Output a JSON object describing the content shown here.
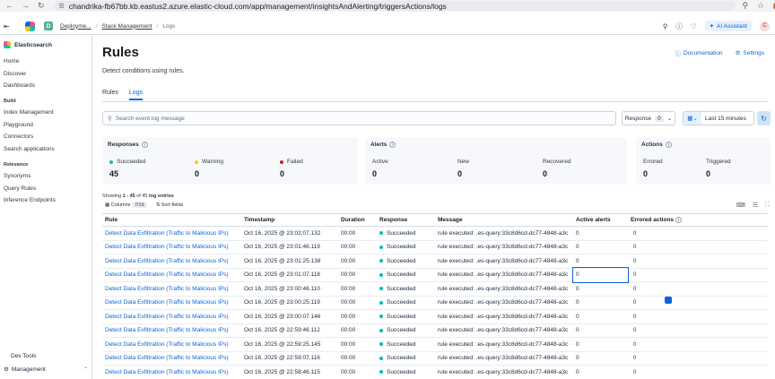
{
  "browser": {
    "url": "chandrika-fb67bb.kb.eastus2.azure.elastic-cloud.com/app/management/insightsAndAlerting/triggersActions/logs"
  },
  "header": {
    "space_initial": "D",
    "breadcrumbs": [
      "Deployme...",
      "Stack Management",
      "Logs"
    ],
    "ai_assistant": "AI Assistant",
    "user_initial": "C"
  },
  "sidebar": {
    "brand": "Elasticsearch",
    "items": [
      "Home",
      "Discover",
      "Dashboards"
    ],
    "build_heading": "Build",
    "build_items": [
      "Index Management",
      "Playground",
      "Connectors",
      "Search applications"
    ],
    "relevance_heading": "Relevance",
    "relevance_items": [
      "Synonyms",
      "Query Rules",
      "Inference Endpoints"
    ],
    "dev_tools": "Dev Tools",
    "management": "Management"
  },
  "page": {
    "title": "Rules",
    "documentation": "Documentation",
    "settings": "Settings",
    "subtitle": "Detect conditions using rules.",
    "tabs": [
      "Rules",
      "Logs"
    ],
    "search_placeholder": "Search event log message",
    "response_label": "Response",
    "response_count": "0",
    "time_range": "Last 15 minutes"
  },
  "responses": {
    "title": "Responses",
    "succeeded_label": "Succeeded",
    "succeeded": "45",
    "warning_label": "Warning",
    "warning": "0",
    "failed_label": "Failed",
    "failed": "0"
  },
  "alerts": {
    "title": "Alerts",
    "active_label": "Active",
    "active": "0",
    "new_label": "New",
    "new": "0",
    "recovered_label": "Recovered",
    "recovered": "0"
  },
  "actions": {
    "title": "Actions",
    "errored_label": "Errored",
    "errored": "0",
    "triggered_label": "Triggered",
    "triggered": "0"
  },
  "table": {
    "showing_prefix": "Showing ",
    "showing_range": "1 - 45",
    "showing_mid": " of 45 ",
    "showing_suffix": "log entries",
    "columns_label": "Columns",
    "columns_count": "7/19",
    "sort_label": "Sort fields",
    "headers": [
      "Rule",
      "Timestamp",
      "Duration",
      "Response",
      "Message",
      "Active alerts",
      "Errored actions"
    ],
    "rows": [
      {
        "rule": "Detect Data Exfiltration (Traffic to Malicious IPs)",
        "ts": "Oct 16, 2025 @ 23:02:07.132",
        "dur": "00:00",
        "resp": "Succeeded",
        "msg": "rule executed: .es-query:33c8d6cd-dc77-4848-a3c",
        "active": "0",
        "err": "0"
      },
      {
        "rule": "Detect Data Exfiltration (Traffic to Malicious IPs)",
        "ts": "Oct 16, 2025 @ 23:01:46.119",
        "dur": "00:00",
        "resp": "Succeeded",
        "msg": "rule executed: .es-query:33c8d6cd-dc77-4848-a3c",
        "active": "0",
        "err": "0"
      },
      {
        "rule": "Detect Data Exfiltration (Traffic to Malicious IPs)",
        "ts": "Oct 16, 2025 @ 23:01:25.138",
        "dur": "00:00",
        "resp": "Succeeded",
        "msg": "rule executed: .es-query:33c8d6cd-dc77-4848-a3c",
        "active": "0",
        "err": "0"
      },
      {
        "rule": "Detect Data Exfiltration (Traffic to Malicious IPs)",
        "ts": "Oct 16, 2025 @ 23:01:07.118",
        "dur": "00:00",
        "resp": "Succeeded",
        "msg": "rule executed: .es-query:33c8d6cd-dc77-4848-a3c",
        "active": "0",
        "err": "0"
      },
      {
        "rule": "Detect Data Exfiltration (Traffic to Malicious IPs)",
        "ts": "Oct 16, 2025 @ 23:00:46.110",
        "dur": "00:00",
        "resp": "Succeeded",
        "msg": "rule executed: .es-query:33c8d6cd-dc77-4848-a3c",
        "active": "0",
        "err": "0"
      },
      {
        "rule": "Detect Data Exfiltration (Traffic to Malicious IPs)",
        "ts": "Oct 16, 2025 @ 23:00:25.119",
        "dur": "00:00",
        "resp": "Succeeded",
        "msg": "rule executed: .es-query:33c8d6cd-dc77-4848-a3c",
        "active": "0",
        "err": "0"
      },
      {
        "rule": "Detect Data Exfiltration (Traffic to Malicious IPs)",
        "ts": "Oct 16, 2025 @ 23:00:07.146",
        "dur": "00:00",
        "resp": "Succeeded",
        "msg": "rule executed: .es-query:33c8d6cd-dc77-4848-a3c",
        "active": "0",
        "err": "0"
      },
      {
        "rule": "Detect Data Exfiltration (Traffic to Malicious IPs)",
        "ts": "Oct 16, 2025 @ 22:59:46.112",
        "dur": "00:00",
        "resp": "Succeeded",
        "msg": "rule executed: .es-query:33c8d6cd-dc77-4848-a3c",
        "active": "0",
        "err": "0"
      },
      {
        "rule": "Detect Data Exfiltration (Traffic to Malicious IPs)",
        "ts": "Oct 16, 2025 @ 22:59:25.145",
        "dur": "00:00",
        "resp": "Succeeded",
        "msg": "rule executed: .es-query:33c8d6cd-dc77-4848-a3c",
        "active": "0",
        "err": "0"
      },
      {
        "rule": "Detect Data Exfiltration (Traffic to Malicious IPs)",
        "ts": "Oct 16, 2025 @ 22:59:07.116",
        "dur": "00:00",
        "resp": "Succeeded",
        "msg": "rule executed: .es-query:33c8d6cd-dc77-4848-a3c",
        "active": "0",
        "err": "0"
      },
      {
        "rule": "Detect Data Exfiltration (Traffic to Malicious IPs)",
        "ts": "Oct 16, 2025 @ 22:58:46.115",
        "dur": "00:00",
        "resp": "Succeeded",
        "msg": "rule executed: .es-query:33c8d6cd-dc77-4848-a3c",
        "active": "0",
        "err": "0"
      }
    ]
  },
  "colors": {
    "accent": "#0b64dd",
    "success": "#00bfb3",
    "warning": "#fec514",
    "danger": "#bd271e"
  }
}
